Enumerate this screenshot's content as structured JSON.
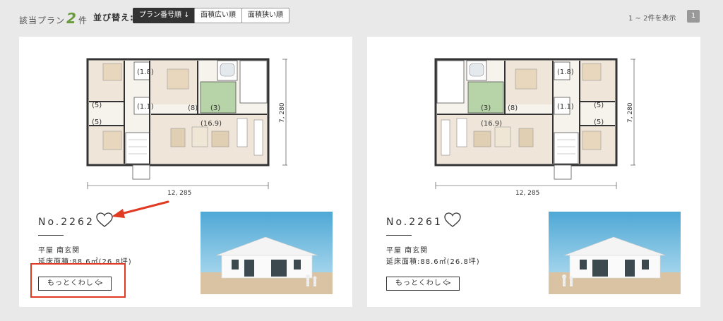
{
  "header": {
    "count_prefix": "該当プラン",
    "count_value": "2",
    "count_suffix": "件",
    "sort_label": "並び替え:",
    "sort_options": [
      {
        "label": "プラン番号順 ↓",
        "active": true
      },
      {
        "label": "面積広い順",
        "active": false
      },
      {
        "label": "面積狭い順",
        "active": false
      }
    ],
    "range_text": "1 ~ 2件を表示",
    "page": "1"
  },
  "plans": [
    {
      "number": "No.2262",
      "style": "平屋 南玄関",
      "area": "延床面積:88.6㎡(26.8坪)",
      "more_label": "もっとくわしく",
      "more_arrow": ">",
      "dim_width": "12, 285",
      "dim_height": "7, 280",
      "rooms": [
        "(1.8)",
        "(1.1)",
        "(5)",
        "(5)",
        "(8)",
        "(3)",
        "(16.9)"
      ]
    },
    {
      "number": "No.2261",
      "style": "平屋 南玄関",
      "area": "延床面積:88.6㎡(26.8坪)",
      "more_label": "もっとくわしく",
      "more_arrow": ">",
      "dim_width": "12, 285",
      "dim_height": "7, 280",
      "rooms": [
        "(1.8)",
        "(1.1)",
        "(5)",
        "(5)",
        "(8)",
        "(3)",
        "(16.9)"
      ]
    }
  ],
  "colors": {
    "accent_green": "#6a9c3f",
    "highlight_red": "#e03a22",
    "tatami_green": "#b7d3a8",
    "floor_wood": "#efe5d8"
  },
  "icons": {
    "favorite": "heart-outline-icon",
    "chevron": "chevron-right-icon"
  }
}
